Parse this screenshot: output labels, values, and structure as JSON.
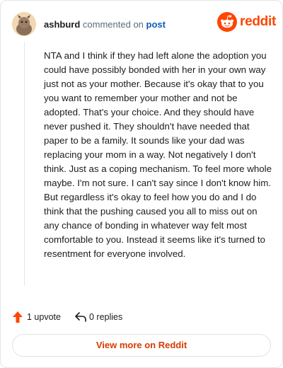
{
  "header": {
    "username": "ashburd",
    "verb": "commented on",
    "post_link": "post",
    "brand": "reddit"
  },
  "comment": {
    "text": "NTA and I think if they had left alone the adoption you could have possibly bonded with her in your own way just not as your mother. Because it's okay that to you you want to remember your mother and not be adopted. That's your choice. And they should have never pushed it. They shouldn't have needed that paper to be a family. It sounds like your dad was replacing your mom in a way. Not negatively I don't think. Just as a coping mechanism. To feel more whole maybe. I'm not sure. I can't say since I don't know him. But regardless it's okay to feel how you do and I do think that the pushing caused you all to miss out on any chance of bonding in whatever way felt most comfortable to you. Instead it seems like it's turned to resentment for everyone involved."
  },
  "actions": {
    "upvote_label": "1 upvote",
    "replies_label": "0 replies",
    "upvote_icon": "upvote-arrow-icon",
    "reply_icon": "reply-arrow-icon"
  },
  "footer": {
    "view_more_label": "View more on Reddit"
  },
  "colors": {
    "brand": "#ff4500",
    "link": "#0a5db8",
    "view_more_text": "#d93a00"
  }
}
